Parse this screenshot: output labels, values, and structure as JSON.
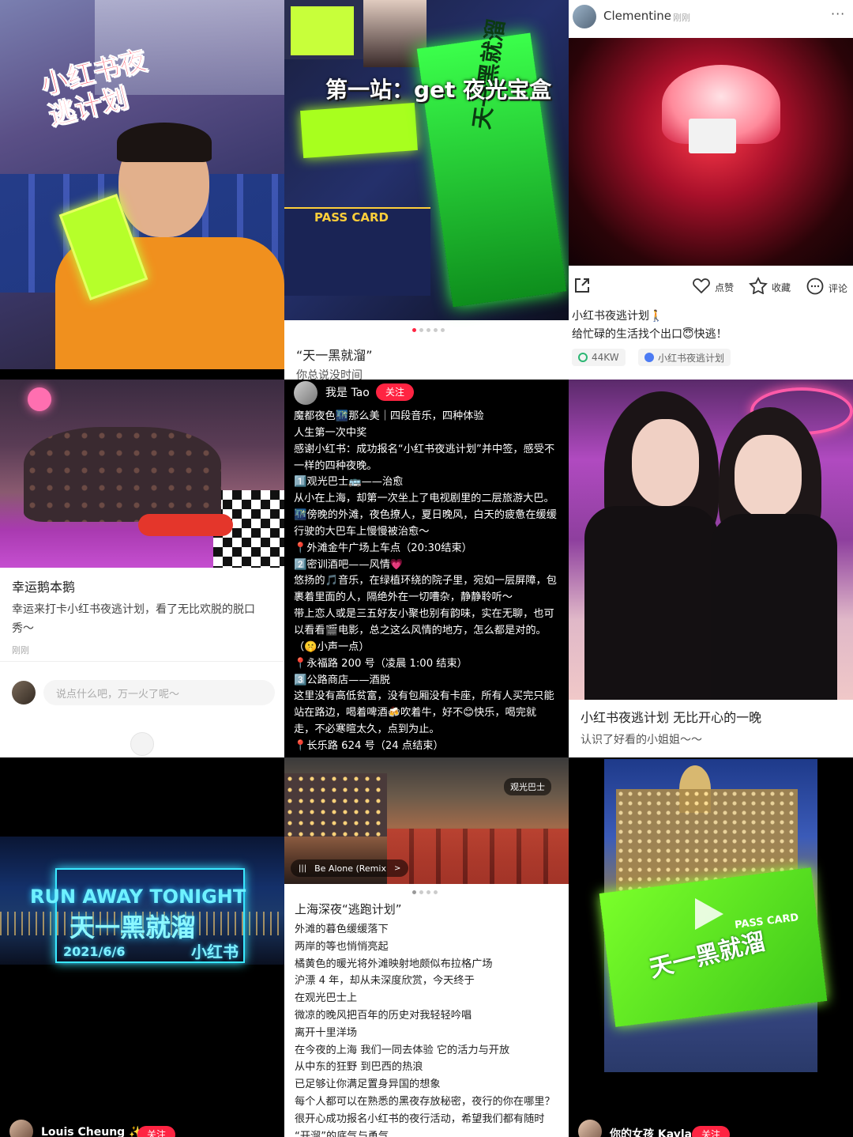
{
  "collage": {
    "p1": {
      "overlay_text": "小红书夜逃计划"
    },
    "p2": {
      "overlay_text": "第一站：get 夜光宝盒",
      "box_text": "天一黑就溜",
      "pass_card": "PASS CARD",
      "title": "“天一黑就溜”",
      "subtitle": "你总说没时间"
    },
    "p3": {
      "author": "Clementine",
      "time": "刚刚",
      "more": "···",
      "like_label": "点赞",
      "fav_label": "收藏",
      "comment_label": "评论",
      "post_title": "小红书夜逃计划🚶",
      "post_body": "给忙碌的生活找个出口😇快逃！",
      "views": "44KW",
      "topic": "小红书夜逃计划"
    },
    "p4": {
      "title": "幸运鹅本鹅",
      "body_line1": "幸运来打卡小红书夜逃计划，看了无比欢脱的脱口",
      "body_line2": "秀～",
      "time": "刚刚",
      "comment_placeholder": "说点什么吧，万一火了呢～"
    },
    "p5": {
      "author": "我是 Tao",
      "follow": "关注",
      "lines": [
        "魔都夜色🌃那么美｜四段音乐，四种体验",
        "人生第一次中奖",
        "感谢小红书：成功报名“小红书夜逃计划”并中签，感受不",
        "一样的四种夜晚。",
        "1️⃣观光巴士🚌——治愈",
        "从小在上海，却第一次坐上了电视剧里的二层旅游大巴。",
        "🌃傍晚的外滩，夜色撩人，夏日晚风，白天的疲惫在缓缓",
        "行驶的大巴车上慢慢被治愈～",
        "📍外滩金牛广场上车点（20:30结束）",
        "2️⃣密训酒吧——风情💗",
        "悠扬的🎵音乐，在绿植环绕的院子里，宛如一层屏障，包",
        "裹着里面的人，隔绝外在一切嘈杂，静静聆听～",
        "带上恋人或是三五好友小聚也别有韵味，实在无聊，也可",
        "以看看🎬电影，总之这么风情的地方，怎么都是对的。",
        "（🤫小声一点）",
        "📍永福路 200 号（凌晨 1:00 结束）",
        "3️⃣公路商店——酒脱",
        "这里没有高低贫富，没有包厢没有卡座，所有人买完只能",
        "站在路边，喝着啤酒🍻吹着牛，好不😊快乐，喝完就",
        "走，不必寒暄太久，点到为止。",
        "📍长乐路 624 号（24 点结束）"
      ]
    },
    "p6": {
      "title": "小红书夜逃计划 无比开心的一晚",
      "body": "认识了好看的小姐姐～～"
    },
    "p7": {
      "line1": "RUN AWAY TONIGHT",
      "line2": "天一黑就溜",
      "date": "2021/6/6",
      "brand": "小红书",
      "author": "Louis Cheung ✨",
      "follow": "关注"
    },
    "p8": {
      "tag": "观光巴士",
      "music": "Be Alone (Remix",
      "title": "上海深夜“逃跑计划”",
      "lines": [
        "外滩的暮色缓缓落下",
        "两岸的等也悄悄亮起",
        "橘黄色的暖光将外滩映射地颇似布拉格广场",
        "沪漂 4 年，却从未深度欣赏，今天终于",
        "在观光巴士上",
        "微凉的晚风把百年的历史对我轻轻吟唱",
        "离开十里洋场",
        "在今夜的上海  我们一同去体验  它的活力与开放",
        "从中东的狂野  到巴西的热浪",
        "已足够让你满足置身异国的想象",
        "每个人都可以在熟悉的黑夜存放秘密，夜行的你在哪里？",
        "很开心成功报名小红书的夜行活动，希望我们都有随时",
        "“开溜”的底气与勇气"
      ]
    },
    "p9": {
      "box_text": "天一黑就溜",
      "pass_card": "PASS CARD",
      "author": "你的女孩 Kayla",
      "follow": "关注"
    }
  }
}
